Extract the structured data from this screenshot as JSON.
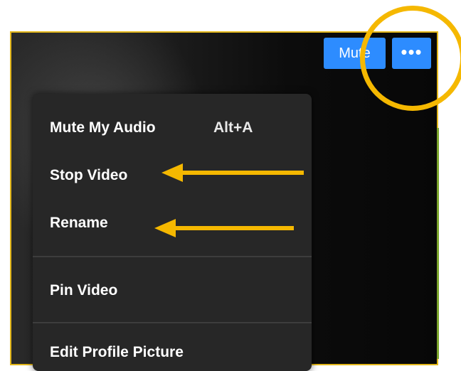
{
  "tile": {
    "mute_button": "Mute",
    "more_button": "•••"
  },
  "menu": {
    "items": [
      {
        "label": "Mute My Audio",
        "shortcut": "Alt+A"
      },
      {
        "label": "Stop Video"
      },
      {
        "label": "Rename"
      },
      {
        "label": "Pin Video"
      },
      {
        "label": "Edit Profile Picture"
      }
    ]
  },
  "colors": {
    "accent_blue": "#2d8cff",
    "annotation": "#f5b800",
    "menu_bg": "#272727",
    "tile_border": "#e2b61a"
  }
}
